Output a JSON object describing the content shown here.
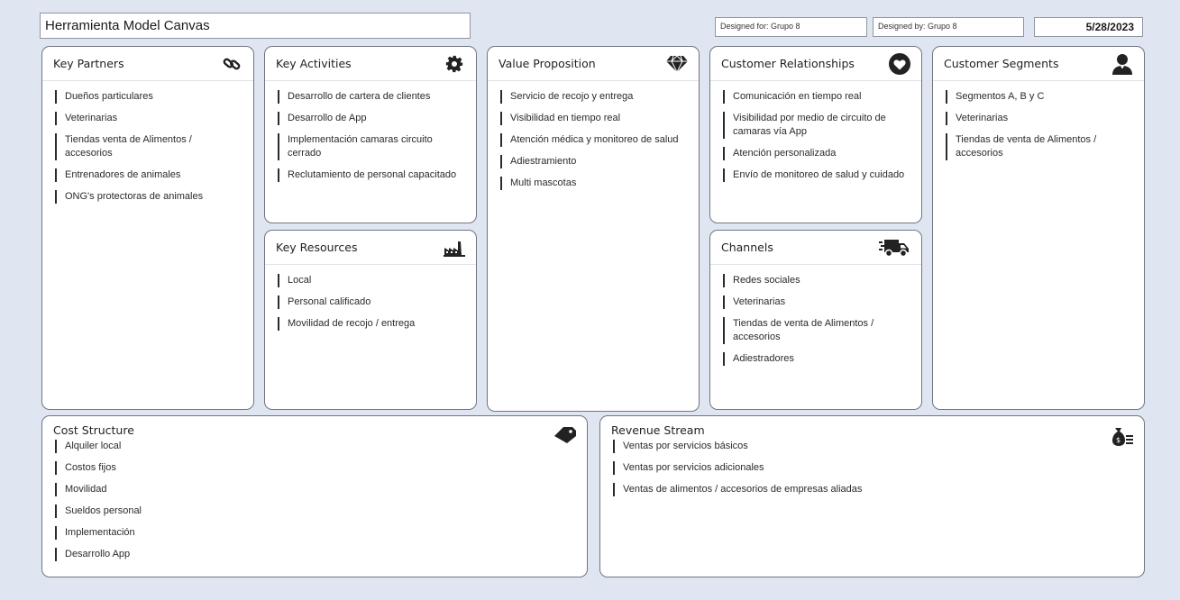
{
  "header": {
    "title": "Herramienta Model Canvas",
    "designed_for": "Designed for: Grupo 8",
    "designed_by": "Designed by:  Grupo 8",
    "date": "5/28/2023"
  },
  "blocks": {
    "key_partners": {
      "title": "Key Partners",
      "icon": "link-icon",
      "items": [
        "Dueños particulares",
        "Veterinarias",
        "Tiendas venta de Alimentos / accesorios",
        "Entrenadores de animales",
        "ONG's protectoras de animales"
      ]
    },
    "key_activities": {
      "title": "Key Activities",
      "icon": "gear-icon",
      "items": [
        "Desarrollo de cartera de clientes",
        "Desarrollo de App",
        "Implementación camaras circuito cerrado",
        "Reclutamiento de personal capacitado"
      ]
    },
    "key_resources": {
      "title": "Key Resources",
      "icon": "factory-icon",
      "items": [
        "Local",
        "Personal calificado",
        "Movilidad de recojo / entrega"
      ]
    },
    "value_proposition": {
      "title": "Value Proposition",
      "icon": "diamond-icon",
      "items": [
        "Servicio de recojo y entrega",
        " Visibilidad en tiempo real",
        "Atención médica y monitoreo de salud",
        "Adiestramiento",
        "Multi mascotas"
      ]
    },
    "customer_relationships": {
      "title": "Customer Relationships",
      "icon": "heart-icon",
      "items": [
        "Comunicación en tiempo real",
        "Visibilidad por medio de circuito de camaras vía App",
        "Atención personalizada",
        "Envío de monitoreo de salud y cuidado"
      ]
    },
    "channels": {
      "title": "Channels",
      "icon": "truck-icon",
      "items": [
        "Redes sociales",
        "Veterinarias",
        "Tiendas de venta de Alimentos / accesorios",
        "Adiestradores"
      ]
    },
    "customer_segments": {
      "title": "Customer Segments",
      "icon": "user-icon",
      "items": [
        "Segmentos A, B y C",
        "Veterinarias",
        "Tiendas de venta de Alimentos / accesorios"
      ]
    },
    "cost_structure": {
      "title": "Cost Structure",
      "icon": "tag-icon",
      "items": [
        "Alquiler local",
        "Costos fijos",
        "Movilidad",
        "Sueldos personal",
        "Implementación",
        "Desarrollo App"
      ]
    },
    "revenue_stream": {
      "title": "Revenue Stream",
      "icon": "money-bag-icon",
      "items": [
        "Ventas por servicios básicos",
        "Ventas por servicios adicionales",
        "Ventas de alimentos / accesorios de empresas aliadas"
      ]
    }
  }
}
